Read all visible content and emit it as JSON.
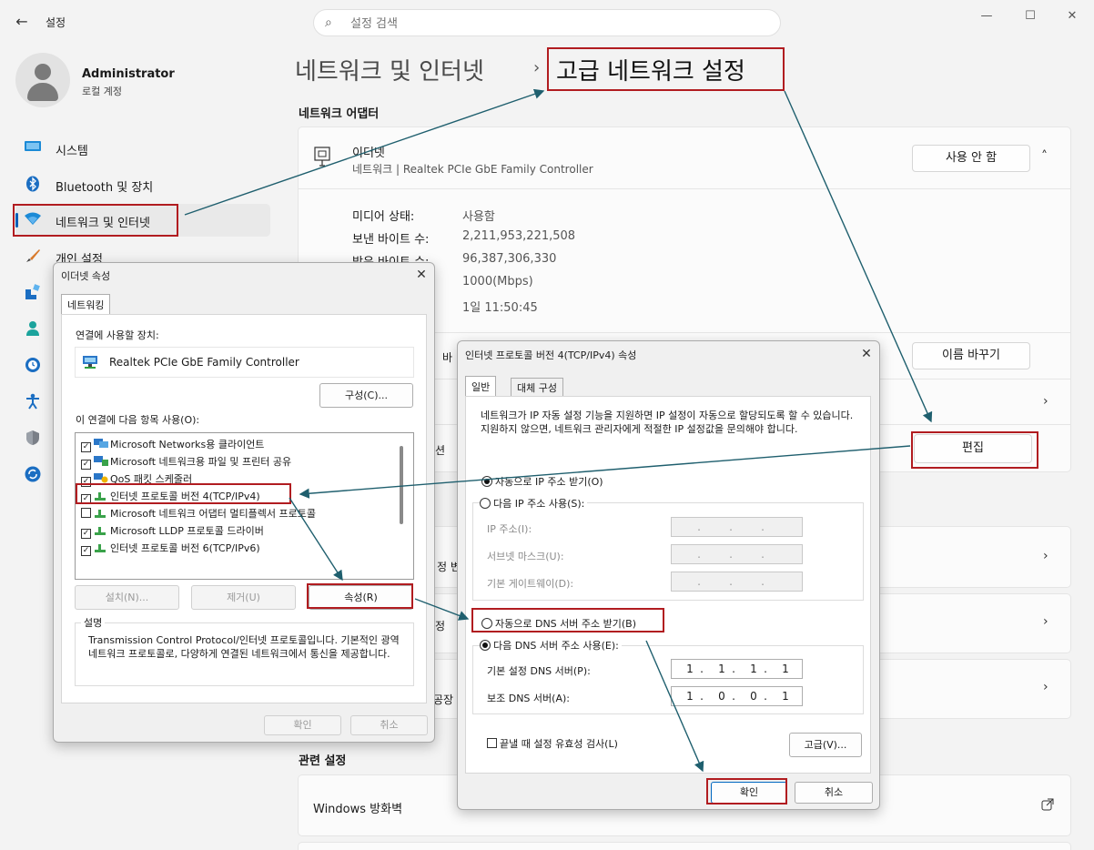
{
  "window": {
    "app_title": "설정",
    "back_label": "←",
    "minimize": "—",
    "maximize": "☐",
    "close": "✕"
  },
  "search": {
    "placeholder": "설정 검색"
  },
  "profile": {
    "name": "Administrator",
    "account_type": "로컬 계정"
  },
  "sidebar": {
    "items": [
      {
        "label": "시스템",
        "icon": "monitor-icon"
      },
      {
        "label": "Bluetooth 및 장치",
        "icon": "bluetooth-icon"
      },
      {
        "label": "네트워크 및 인터넷",
        "icon": "wifi-icon",
        "active": true
      },
      {
        "label": "개인 설정",
        "icon": "brush-icon"
      },
      {
        "label": "",
        "icon": "apps-icon"
      },
      {
        "label": "",
        "icon": "accounts-icon"
      },
      {
        "label": "",
        "icon": "time-language-icon"
      },
      {
        "label": "",
        "icon": "accessibility-icon"
      },
      {
        "label": "",
        "icon": "shield-icon"
      },
      {
        "label": "",
        "icon": "update-icon"
      }
    ]
  },
  "breadcrumb": {
    "parent": "네트워크 및 인터넷",
    "separator": "›",
    "current": "고급 네트워크 설정"
  },
  "adapters": {
    "heading": "네트워크 어댑터",
    "ethernet": {
      "name": "이더넷",
      "desc": "네트워크 | Realtek PCIe GbE Family Controller",
      "disable_button": "사용 안 함",
      "details": [
        {
          "label": "미디어 상태:",
          "value": "사용함"
        },
        {
          "label": "보낸 바이트 수:",
          "value": "2,211,953,221,508"
        },
        {
          "label": "받은 바이트 수:",
          "value": "96,387,306,330"
        },
        {
          "label": "",
          "value": "1000(Mbps)"
        },
        {
          "label": "",
          "value": "1일 11:50:45"
        }
      ],
      "rename_button": "이름 바꾸기",
      "row_fragment_1": "바",
      "row_fragment_2": "션",
      "edit_button": "편집"
    },
    "more_fragments": [
      "정 변",
      "정",
      "공장"
    ]
  },
  "related": {
    "heading": "관련 설정",
    "firewall": "Windows 방화벽"
  },
  "ethernet_props": {
    "title": "이더넷 속성",
    "tab": "네트워킹",
    "connect_using_label": "연결에 사용할 장치:",
    "adapter_name": "Realtek PCIe GbE Family Controller",
    "configure_button": "구성(C)...",
    "items_label": "이 연결에 다음 항목 사용(O):",
    "items": [
      {
        "label": "Microsoft Networks용 클라이언트",
        "checked": true
      },
      {
        "label": "Microsoft 네트워크용 파일 및 프린터 공유",
        "checked": true
      },
      {
        "label": "QoS 패킷 스케줄러",
        "checked": true
      },
      {
        "label": "인터넷 프로토콜 버전 4(TCP/IPv4)",
        "checked": true
      },
      {
        "label": "Microsoft 네트워크 어댑터 멀티플렉서 프로토콜",
        "checked": false
      },
      {
        "label": "Microsoft LLDP 프로토콜 드라이버",
        "checked": true
      },
      {
        "label": "인터넷 프로토콜 버전 6(TCP/IPv6)",
        "checked": true
      }
    ],
    "install_button": "설치(N)...",
    "remove_button": "제거(U)",
    "properties_button": "속성(R)",
    "description_label": "설명",
    "description": "Transmission Control Protocol/인터넷 프로토콜입니다. 기본적인 광역 네트워크 프로토콜로, 다양하게 연결된 네트워크에서 통신을 제공합니다.",
    "ok_button": "확인",
    "cancel_button": "취소"
  },
  "ipv4_props": {
    "title": "인터넷 프로토콜 버전 4(TCP/IPv4) 속성",
    "tab_general": "일반",
    "tab_alternate": "대체 구성",
    "intro": "네트워크가 IP 자동 설정 기능을 지원하면 IP 설정이 자동으로 할당되도록 할 수 있습니다. 지원하지 않으면, 네트워크 관리자에게 적절한 IP 설정값을 문의해야 합니다.",
    "auto_ip": "자동으로 IP 주소 받기(O)",
    "manual_ip": "다음 IP 주소 사용(S):",
    "ip_label": "IP 주소(I):",
    "subnet_label": "서브넷 마스크(U):",
    "gateway_label": "기본 게이트웨이(D):",
    "auto_dns": "자동으로 DNS 서버 주소 받기(B)",
    "manual_dns": "다음 DNS 서버 주소 사용(E):",
    "preferred_dns_label": "기본 설정 DNS 서버(P):",
    "preferred_dns": [
      "1",
      "1",
      "1",
      "1"
    ],
    "alternate_dns_label": "보조 DNS 서버(A):",
    "alternate_dns": [
      "1",
      "0",
      "0",
      "1"
    ],
    "validate_on_exit": "끝낼 때 설정 유효성 검사(L)",
    "advanced_button": "고급(V)...",
    "ok_button": "확인",
    "cancel_button": "취소"
  },
  "annotation_color": "#b11c20",
  "arrow_color": "#1f5f6e"
}
